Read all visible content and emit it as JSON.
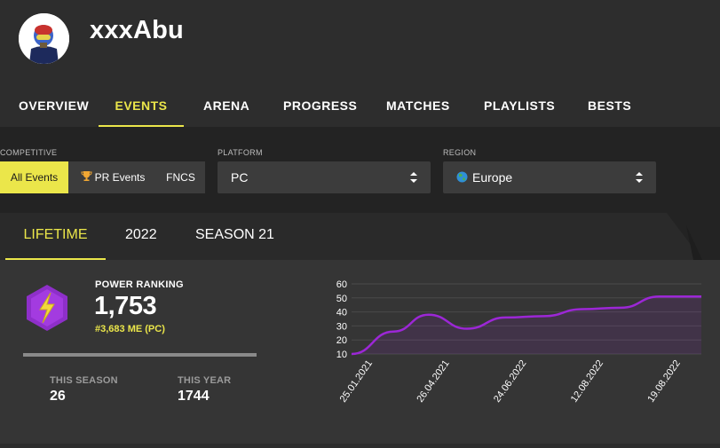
{
  "profile": {
    "username": "xxxAbu",
    "avatar_icon": "avatar-helmet-icon"
  },
  "nav": {
    "items": [
      "OVERVIEW",
      "EVENTS",
      "ARENA",
      "PROGRESS",
      "MATCHES",
      "PLAYLISTS",
      "BESTS"
    ],
    "active": "EVENTS"
  },
  "filters": {
    "competitive_label": "COMPETITIVE",
    "competitive_options": [
      "All Events",
      "PR Events",
      "FNCS"
    ],
    "competitive_selected": "All Events",
    "pr_icon": "trophy-icon",
    "platform_label": "PLATFORM",
    "platform_value": "PC",
    "region_label": "REGION",
    "region_value": "Europe",
    "region_icon": "globe-icon"
  },
  "tabs": {
    "items": [
      "LIFETIME",
      "2022",
      "SEASON 21"
    ],
    "active": "LIFETIME"
  },
  "power_ranking": {
    "title": "POWER RANKING",
    "value": "1,753",
    "rank": "#3,683 ME (PC)",
    "icon": "lightning-hexagon-icon",
    "progress_fraction": 1.0,
    "this_season_label": "THIS SEASON",
    "this_season_value": "26",
    "this_year_label": "THIS YEAR",
    "this_year_value": "1744"
  },
  "colors": {
    "accent": "#ebe64a",
    "line": "#9c27d6",
    "badge": "#8e2fc9"
  },
  "chart_data": {
    "type": "line",
    "x_ticks": [
      "25.01.2021",
      "26.04.2021",
      "24.06.2022",
      "12.08.2022",
      "19.08.2022"
    ],
    "x": [
      0,
      0.12,
      0.22,
      0.33,
      0.44,
      0.55,
      0.66,
      0.77,
      0.88,
      1.0
    ],
    "values": [
      10,
      26,
      38,
      28,
      36,
      37,
      42,
      43,
      51,
      51
    ],
    "ylim": [
      10,
      60
    ],
    "yticks": [
      10,
      20,
      30,
      40,
      50,
      60
    ],
    "grid": true,
    "legend": "none"
  }
}
